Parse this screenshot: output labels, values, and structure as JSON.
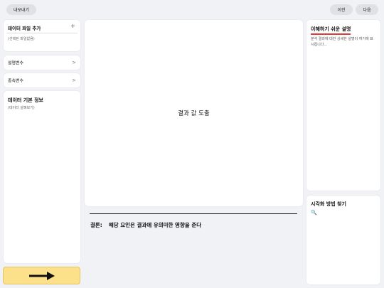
{
  "toolbar": {
    "export_label": "내보내기",
    "prev_label": "이전",
    "next_label": "다음"
  },
  "left": {
    "add_data_title": "데이터 파일 추가",
    "add_data_plus": "+",
    "add_data_sub": "(선택된 파일없음)",
    "explanatory_label": "설명변수",
    "explanatory_chevron": ">",
    "dependent_label": "종속변수",
    "dependent_chevron": ">",
    "info_title": "데이터 기본 정보",
    "info_sub": "(데이터 살펴보기)"
  },
  "center": {
    "result_title": "결과 값 도출",
    "conclusion_label": "결론:",
    "conclusion_text": "해당 요인은 결과에 유의미한 영향을 준다"
  },
  "right": {
    "explain_title": "이해하기 쉬운 설명",
    "explain_body": "분석 결과에 대한 상세한 설명이 여기에 표시됩니다...",
    "viz_title": "시각화 방법 찾기",
    "viz_icon": "🔍"
  },
  "colors": {
    "accent_yellow": "#fde08a",
    "underline_red": "#e03b3b"
  }
}
